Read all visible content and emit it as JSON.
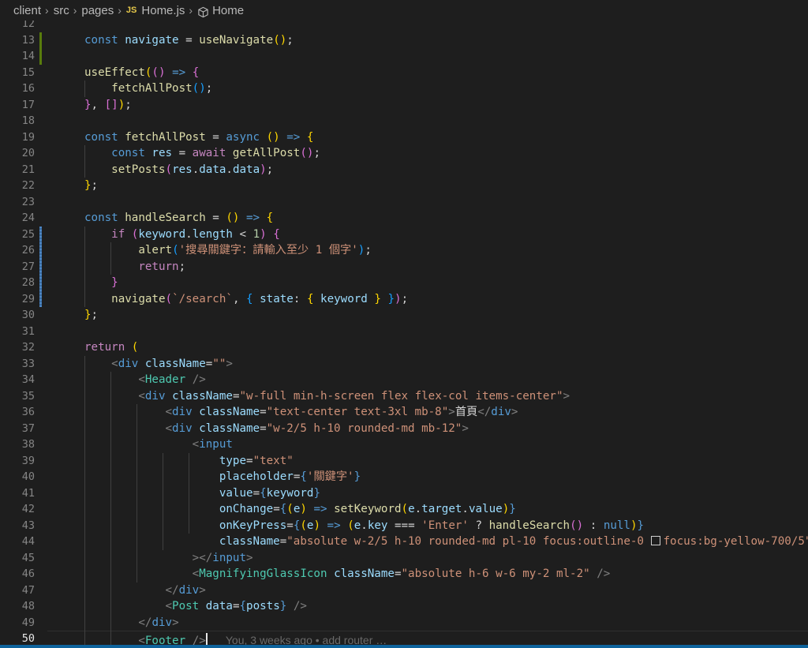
{
  "breadcrumb": {
    "items": [
      "client",
      "src",
      "pages"
    ],
    "file_badge": "JS",
    "file": "Home.js",
    "symbol": "Home"
  },
  "editor": {
    "active_line": 50,
    "blame": "You, 3 weeks ago • add router …",
    "swatch_color": "#00000000",
    "lines": [
      {
        "n": "12",
        "tokens": []
      },
      {
        "n": "13",
        "tokens": [
          [
            "kw",
            "const "
          ],
          [
            "var",
            "navigate"
          ],
          [
            "txt",
            " = "
          ],
          [
            "fn",
            "useNavigate"
          ],
          [
            "br1",
            "()"
          ],
          [
            "txt",
            ";"
          ]
        ]
      },
      {
        "n": "14",
        "tokens": []
      },
      {
        "n": "15",
        "tokens": [
          [
            "fn",
            "useEffect"
          ],
          [
            "br1",
            "("
          ],
          [
            "br2",
            "()"
          ],
          [
            "txt",
            " "
          ],
          [
            "kw",
            "=>"
          ],
          [
            "txt",
            " "
          ],
          [
            "br2",
            "{"
          ]
        ]
      },
      {
        "n": "16",
        "tokens": [
          [
            "txt",
            "    "
          ],
          [
            "fn",
            "fetchAllPost"
          ],
          [
            "br3",
            "()"
          ],
          [
            "txt",
            ";"
          ]
        ]
      },
      {
        "n": "17",
        "tokens": [
          [
            "br2",
            "}"
          ],
          [
            "txt",
            ", "
          ],
          [
            "br2",
            "[]"
          ],
          [
            "br1",
            ")"
          ],
          [
            "txt",
            ";"
          ]
        ]
      },
      {
        "n": "18",
        "tokens": []
      },
      {
        "n": "19",
        "tokens": [
          [
            "kw",
            "const "
          ],
          [
            "fn",
            "fetchAllPost"
          ],
          [
            "txt",
            " = "
          ],
          [
            "kw",
            "async "
          ],
          [
            "br1",
            "()"
          ],
          [
            "txt",
            " "
          ],
          [
            "kw",
            "=>"
          ],
          [
            "txt",
            " "
          ],
          [
            "br1",
            "{"
          ]
        ]
      },
      {
        "n": "20",
        "tokens": [
          [
            "txt",
            "    "
          ],
          [
            "kw",
            "const "
          ],
          [
            "var",
            "res"
          ],
          [
            "txt",
            " = "
          ],
          [
            "ctl",
            "await "
          ],
          [
            "fn",
            "getAllPost"
          ],
          [
            "br2",
            "()"
          ],
          [
            "txt",
            ";"
          ]
        ]
      },
      {
        "n": "21",
        "tokens": [
          [
            "txt",
            "    "
          ],
          [
            "fn",
            "setPosts"
          ],
          [
            "br2",
            "("
          ],
          [
            "var",
            "res"
          ],
          [
            "txt",
            "."
          ],
          [
            "var",
            "data"
          ],
          [
            "txt",
            "."
          ],
          [
            "var",
            "data"
          ],
          [
            "br2",
            ")"
          ],
          [
            "txt",
            ";"
          ]
        ]
      },
      {
        "n": "22",
        "tokens": [
          [
            "br1",
            "}"
          ],
          [
            "txt",
            ";"
          ]
        ]
      },
      {
        "n": "23",
        "tokens": []
      },
      {
        "n": "24",
        "tokens": [
          [
            "kw",
            "const "
          ],
          [
            "fn",
            "handleSearch"
          ],
          [
            "txt",
            " = "
          ],
          [
            "br1",
            "()"
          ],
          [
            "txt",
            " "
          ],
          [
            "kw",
            "=>"
          ],
          [
            "txt",
            " "
          ],
          [
            "br1",
            "{"
          ]
        ]
      },
      {
        "n": "25",
        "tokens": [
          [
            "txt",
            "    "
          ],
          [
            "ctl",
            "if "
          ],
          [
            "br2",
            "("
          ],
          [
            "var",
            "keyword"
          ],
          [
            "txt",
            "."
          ],
          [
            "var",
            "length"
          ],
          [
            "txt",
            " < "
          ],
          [
            "num",
            "1"
          ],
          [
            "br2",
            ")"
          ],
          [
            "txt",
            " "
          ],
          [
            "br2",
            "{"
          ]
        ]
      },
      {
        "n": "26",
        "tokens": [
          [
            "txt",
            "        "
          ],
          [
            "fn",
            "alert"
          ],
          [
            "br3",
            "("
          ],
          [
            "str",
            "'搜尋關鍵字：請輸入至少 1 個字'"
          ],
          [
            "br3",
            ")"
          ],
          [
            "txt",
            ";"
          ]
        ]
      },
      {
        "n": "27",
        "tokens": [
          [
            "txt",
            "        "
          ],
          [
            "ctl",
            "return"
          ],
          [
            "txt",
            ";"
          ]
        ]
      },
      {
        "n": "28",
        "tokens": [
          [
            "txt",
            "    "
          ],
          [
            "br2",
            "}"
          ]
        ]
      },
      {
        "n": "29",
        "tokens": [
          [
            "txt",
            "    "
          ],
          [
            "fn",
            "navigate"
          ],
          [
            "br2",
            "("
          ],
          [
            "str",
            "`/search`"
          ],
          [
            "txt",
            ", "
          ],
          [
            "br3",
            "{"
          ],
          [
            "txt",
            " "
          ],
          [
            "var",
            "state"
          ],
          [
            "txt",
            ": "
          ],
          [
            "br1",
            "{"
          ],
          [
            "txt",
            " "
          ],
          [
            "var",
            "keyword"
          ],
          [
            "txt",
            " "
          ],
          [
            "br1",
            "}"
          ],
          [
            "txt",
            " "
          ],
          [
            "br3",
            "}"
          ],
          [
            "br2",
            ")"
          ],
          [
            "txt",
            ";"
          ]
        ]
      },
      {
        "n": "30",
        "tokens": [
          [
            "br1",
            "}"
          ],
          [
            "txt",
            ";"
          ]
        ]
      },
      {
        "n": "31",
        "tokens": []
      },
      {
        "n": "32",
        "tokens": [
          [
            "ctl",
            "return "
          ],
          [
            "br1",
            "("
          ]
        ]
      },
      {
        "n": "33",
        "tokens": [
          [
            "txt",
            "    "
          ],
          [
            "punc",
            "<"
          ],
          [
            "tag",
            "div"
          ],
          [
            "txt",
            " "
          ],
          [
            "attr",
            "className"
          ],
          [
            "txt",
            "="
          ],
          [
            "str",
            "\"\""
          ],
          [
            "punc",
            ">"
          ]
        ]
      },
      {
        "n": "34",
        "tokens": [
          [
            "txt",
            "        "
          ],
          [
            "punc",
            "<"
          ],
          [
            "comp",
            "Header"
          ],
          [
            "txt",
            " "
          ],
          [
            "punc",
            "/>"
          ]
        ]
      },
      {
        "n": "35",
        "tokens": [
          [
            "txt",
            "        "
          ],
          [
            "punc",
            "<"
          ],
          [
            "tag",
            "div"
          ],
          [
            "txt",
            " "
          ],
          [
            "attr",
            "className"
          ],
          [
            "txt",
            "="
          ],
          [
            "str",
            "\"w-full min-h-screen flex flex-col items-center\""
          ],
          [
            "punc",
            ">"
          ]
        ]
      },
      {
        "n": "36",
        "tokens": [
          [
            "txt",
            "            "
          ],
          [
            "punc",
            "<"
          ],
          [
            "tag",
            "div"
          ],
          [
            "txt",
            " "
          ],
          [
            "attr",
            "className"
          ],
          [
            "txt",
            "="
          ],
          [
            "str",
            "\"text-center text-3xl mb-8\""
          ],
          [
            "punc",
            ">"
          ],
          [
            "txt",
            "首頁"
          ],
          [
            "punc",
            "</"
          ],
          [
            "tag",
            "div"
          ],
          [
            "punc",
            ">"
          ]
        ]
      },
      {
        "n": "37",
        "tokens": [
          [
            "txt",
            "            "
          ],
          [
            "punc",
            "<"
          ],
          [
            "tag",
            "div"
          ],
          [
            "txt",
            " "
          ],
          [
            "attr",
            "className"
          ],
          [
            "txt",
            "="
          ],
          [
            "str",
            "\"w-2/5 h-10 rounded-md mb-12\""
          ],
          [
            "punc",
            ">"
          ]
        ]
      },
      {
        "n": "38",
        "tokens": [
          [
            "txt",
            "                "
          ],
          [
            "punc",
            "<"
          ],
          [
            "tag",
            "input"
          ]
        ]
      },
      {
        "n": "39",
        "tokens": [
          [
            "txt",
            "                    "
          ],
          [
            "attr",
            "type"
          ],
          [
            "txt",
            "="
          ],
          [
            "str",
            "\"text\""
          ]
        ]
      },
      {
        "n": "40",
        "tokens": [
          [
            "txt",
            "                    "
          ],
          [
            "attr",
            "placeholder"
          ],
          [
            "txt",
            "="
          ],
          [
            "kw",
            "{"
          ],
          [
            "str",
            "'關鍵字'"
          ],
          [
            "kw",
            "}"
          ]
        ]
      },
      {
        "n": "41",
        "tokens": [
          [
            "txt",
            "                    "
          ],
          [
            "attr",
            "value"
          ],
          [
            "txt",
            "="
          ],
          [
            "kw",
            "{"
          ],
          [
            "var",
            "keyword"
          ],
          [
            "kw",
            "}"
          ]
        ]
      },
      {
        "n": "42",
        "tokens": [
          [
            "txt",
            "                    "
          ],
          [
            "attr",
            "onChange"
          ],
          [
            "txt",
            "="
          ],
          [
            "kw",
            "{"
          ],
          [
            "br1",
            "("
          ],
          [
            "var",
            "e"
          ],
          [
            "br1",
            ")"
          ],
          [
            "txt",
            " "
          ],
          [
            "kw",
            "=>"
          ],
          [
            "txt",
            " "
          ],
          [
            "fn",
            "setKeyword"
          ],
          [
            "br1",
            "("
          ],
          [
            "var",
            "e"
          ],
          [
            "txt",
            "."
          ],
          [
            "var",
            "target"
          ],
          [
            "txt",
            "."
          ],
          [
            "var",
            "value"
          ],
          [
            "br1",
            ")"
          ],
          [
            "kw",
            "}"
          ]
        ]
      },
      {
        "n": "43",
        "tokens": [
          [
            "txt",
            "                    "
          ],
          [
            "attr",
            "onKeyPress"
          ],
          [
            "txt",
            "="
          ],
          [
            "kw",
            "{"
          ],
          [
            "br1",
            "("
          ],
          [
            "var",
            "e"
          ],
          [
            "br1",
            ")"
          ],
          [
            "txt",
            " "
          ],
          [
            "kw",
            "=>"
          ],
          [
            "txt",
            " "
          ],
          [
            "br1",
            "("
          ],
          [
            "var",
            "e"
          ],
          [
            "txt",
            "."
          ],
          [
            "var",
            "key"
          ],
          [
            "txt",
            " === "
          ],
          [
            "str",
            "'Enter'"
          ],
          [
            "txt",
            " ? "
          ],
          [
            "fn",
            "handleSearch"
          ],
          [
            "br2",
            "()"
          ],
          [
            "txt",
            " : "
          ],
          [
            "kw",
            "null"
          ],
          [
            "br1",
            ")"
          ],
          [
            "kw",
            "}"
          ]
        ]
      },
      {
        "n": "44",
        "tokens": [
          [
            "txt",
            "                    "
          ],
          [
            "attr",
            "className"
          ],
          [
            "txt",
            "="
          ],
          [
            "str",
            "\"absolute w-2/5 h-10 rounded-md pl-10 focus:outline-0 "
          ],
          [
            "swatch",
            ""
          ],
          [
            "str",
            "focus:bg-yellow-700/5\""
          ]
        ]
      },
      {
        "n": "45",
        "tokens": [
          [
            "txt",
            "                "
          ],
          [
            "punc",
            "></"
          ],
          [
            "tag",
            "input"
          ],
          [
            "punc",
            ">"
          ]
        ]
      },
      {
        "n": "46",
        "tokens": [
          [
            "txt",
            "                "
          ],
          [
            "punc",
            "<"
          ],
          [
            "comp",
            "MagnifyingGlassIcon"
          ],
          [
            "txt",
            " "
          ],
          [
            "attr",
            "className"
          ],
          [
            "txt",
            "="
          ],
          [
            "str",
            "\"absolute h-6 w-6 my-2 ml-2\""
          ],
          [
            "txt",
            " "
          ],
          [
            "punc",
            "/>"
          ]
        ]
      },
      {
        "n": "47",
        "tokens": [
          [
            "txt",
            "            "
          ],
          [
            "punc",
            "</"
          ],
          [
            "tag",
            "div"
          ],
          [
            "punc",
            ">"
          ]
        ]
      },
      {
        "n": "48",
        "tokens": [
          [
            "txt",
            "            "
          ],
          [
            "punc",
            "<"
          ],
          [
            "comp",
            "Post"
          ],
          [
            "txt",
            " "
          ],
          [
            "attr",
            "data"
          ],
          [
            "txt",
            "="
          ],
          [
            "kw",
            "{"
          ],
          [
            "var",
            "posts"
          ],
          [
            "kw",
            "}"
          ],
          [
            "txt",
            " "
          ],
          [
            "punc",
            "/>"
          ]
        ]
      },
      {
        "n": "49",
        "tokens": [
          [
            "txt",
            "        "
          ],
          [
            "punc",
            "</"
          ],
          [
            "tag",
            "div"
          ],
          [
            "punc",
            ">"
          ]
        ]
      },
      {
        "n": "50",
        "tokens": [
          [
            "txt",
            "        "
          ],
          [
            "punc",
            "<"
          ],
          [
            "comp",
            "Footer"
          ],
          [
            "txt",
            " "
          ],
          [
            "punc",
            "/>"
          ]
        ]
      }
    ]
  }
}
